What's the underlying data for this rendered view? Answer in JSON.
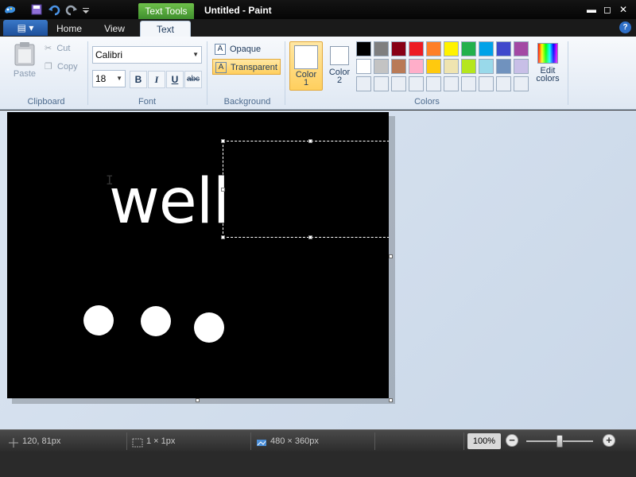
{
  "window": {
    "title": "Untitled - Paint",
    "context_tab": "Text Tools",
    "controls": {
      "minimize": "▬",
      "maximize": "◻",
      "close": "✕"
    }
  },
  "tabs": {
    "file_icon": "▤",
    "file_arrow": "▾",
    "items": [
      "Home",
      "View",
      "Text"
    ],
    "active": "Text",
    "help_icon": "?"
  },
  "ribbon": {
    "clipboard": {
      "label": "Clipboard",
      "paste": "Paste",
      "cut": "Cut",
      "copy": "Copy"
    },
    "font": {
      "label": "Font",
      "family": "Calibri",
      "size": "18",
      "bold": "B",
      "italic": "I",
      "underline": "U",
      "strike": "abc"
    },
    "background": {
      "label": "Background",
      "opaque": "Opaque",
      "transparent": "Transparent",
      "selected": "Transparent"
    },
    "colors": {
      "label": "Colors",
      "color1": "Color\n1",
      "color1_line1": "Color",
      "color1_line2": "1",
      "color2_line1": "Color",
      "color2_line2": "2",
      "color1_value": "#ffffff",
      "color2_value": "#ffffff",
      "edit_line1": "Edit",
      "edit_line2": "colors",
      "palette": [
        [
          "#000000",
          "#7f7f7f",
          "#880015",
          "#ed1c24",
          "#ff7f27",
          "#fff200",
          "#22b14c",
          "#00a2e8",
          "#3f48cc",
          "#a349a4"
        ],
        [
          "#ffffff",
          "#c3c3c3",
          "#b97a57",
          "#ffaec9",
          "#ffc90e",
          "#efe4b0",
          "#b5e61d",
          "#99d9ea",
          "#7092be",
          "#c8bfe7"
        ],
        [
          "#e9eef5",
          "#e9eef5",
          "#e9eef5",
          "#e9eef5",
          "#e9eef5",
          "#e9eef5",
          "#e9eef5",
          "#e9eef5",
          "#e9eef5",
          "#e9eef5"
        ]
      ]
    }
  },
  "canvas": {
    "text": "well",
    "background": "#000000",
    "foreground": "#ffffff"
  },
  "status": {
    "cursor_pos": "120, 81px",
    "selection_size": "1 × 1px",
    "image_size": "480 × 360px",
    "zoom": "100%",
    "zoom_level_fraction": 0.5
  }
}
